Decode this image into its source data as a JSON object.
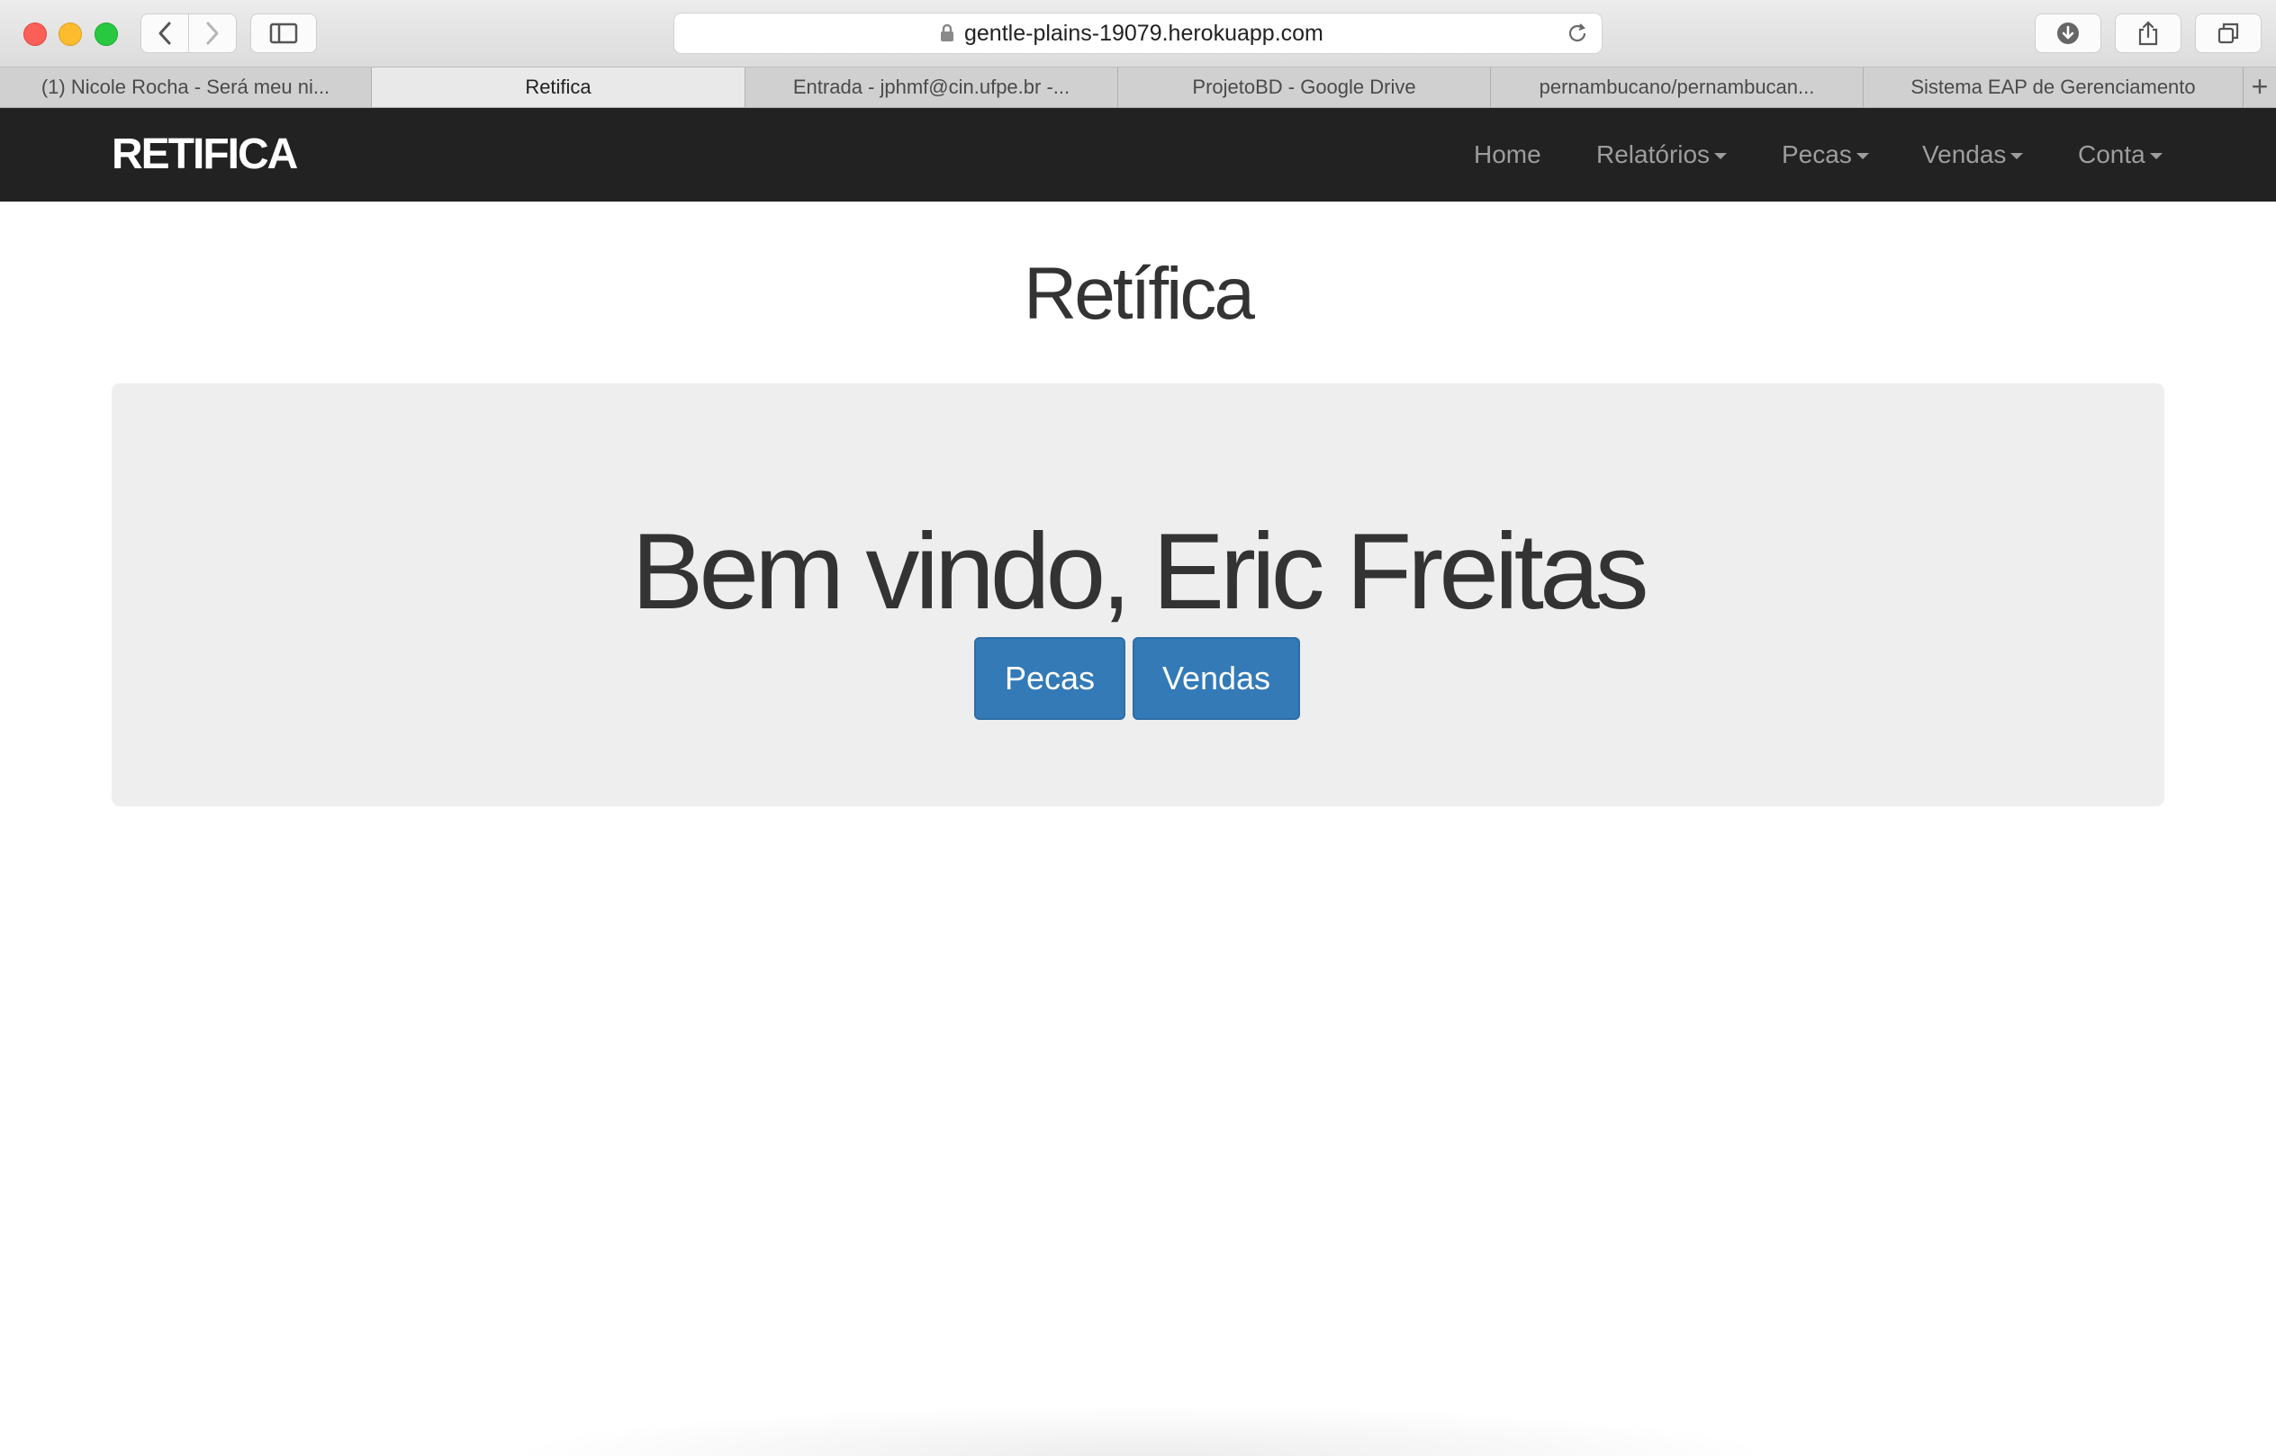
{
  "browser": {
    "url": "gentle-plains-19079.herokuapp.com",
    "tabs": [
      {
        "label": "(1) Nicole Rocha - Será meu ni..."
      },
      {
        "label": "Retifica"
      },
      {
        "label": "Entrada - jphmf@cin.ufpe.br -..."
      },
      {
        "label": "ProjetoBD - Google Drive"
      },
      {
        "label": "pernambucano/pernambucan..."
      },
      {
        "label": "Sistema EAP de Gerenciamento"
      }
    ],
    "active_tab": 1,
    "new_tab_symbol": "+",
    "icons": [
      "back-icon",
      "forward-icon",
      "sidebar-icon",
      "lock-icon",
      "reload-icon",
      "download-icon",
      "share-icon",
      "tabs-overview-icon"
    ]
  },
  "navbar": {
    "brand": "RETIFICA",
    "items": [
      {
        "label": "Home",
        "dropdown": false
      },
      {
        "label": "Relatórios",
        "dropdown": true
      },
      {
        "label": "Pecas",
        "dropdown": true
      },
      {
        "label": "Vendas",
        "dropdown": true
      },
      {
        "label": "Conta",
        "dropdown": true
      }
    ]
  },
  "page": {
    "title": "Retífica",
    "welcome": "Bem vindo, Eric Freitas",
    "buttons": {
      "pecas": "Pecas",
      "vendas": "Vendas"
    }
  },
  "colors": {
    "navbar_bg": "#222222",
    "nav_text": "#9d9d9d",
    "jumbotron_bg": "#eeeeee",
    "primary_button": "#337ab7"
  }
}
